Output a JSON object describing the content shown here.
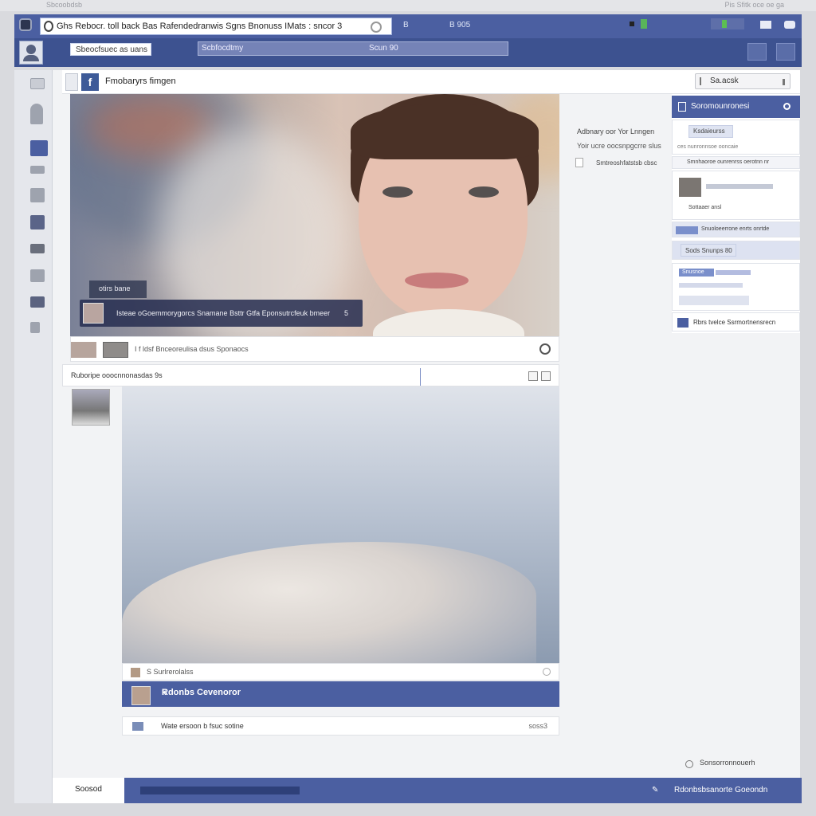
{
  "os_bar": {
    "left_text": "Sbcoobdsb",
    "right_text": "Pis Sfitk oce oe ga"
  },
  "browser": {
    "address": "Ghs Rebocr. toll back Bas Rafendedranwis Sgns Bnonuss IMats : sncor 3",
    "tab_text_1": "B",
    "tab_text_2": "B 905",
    "nav_search": "Sbeocfsuec as uans",
    "nav_bar_left": "Scbfocdtmy",
    "nav_bar_right": "Scun 90"
  },
  "page": {
    "title": "Fmobaryrs fimgen",
    "search": "Sa.acsk",
    "logo_letter": "f"
  },
  "post1": {
    "caption_small": "otirs bane",
    "caption": "Isteae oGoemmorygorcs Snamane Bsttr Gtfa Eponsutrcfeuk bmeer",
    "caption_count": "5",
    "footer_text": "I f ldsf Bnceoreulisa dsus Sponaocs"
  },
  "post2": {
    "header": "Ruboripe ooocnnonasdas 9s",
    "meta": "S Surlrerolalss",
    "author": "Rdonbs Cevenoror",
    "author_close": "k",
    "comment": "Wate ersoon b fsuc sotine",
    "comment_right": "soss3"
  },
  "middle": {
    "line1": "Adbnary oor Yor Lnngen",
    "line2": "Yoir ucre oocsnpgcrre slus",
    "line3": "Smtreoshfatstsb cbsc"
  },
  "sidebar": {
    "header": "Soromounronesi",
    "row1": "Ksdaieurss",
    "row1_sub": "ces nunronnsoe ooncaie",
    "row2": "Smnhaoroe ounrenrss oerotnn nr",
    "row3": "Sottaaer ansl",
    "row4": "Snuoloeerrone enrts onrtde",
    "row5": "Sods Snunps 80",
    "row6": "Snusnoe",
    "row7": "Rbrs tvelce Ssrmortnensrecn"
  },
  "footer_link": "Sonsorronnouerh",
  "bottom": {
    "tab": "Soosod",
    "right_text": "Rdonbsbsanorte Goeondn"
  }
}
